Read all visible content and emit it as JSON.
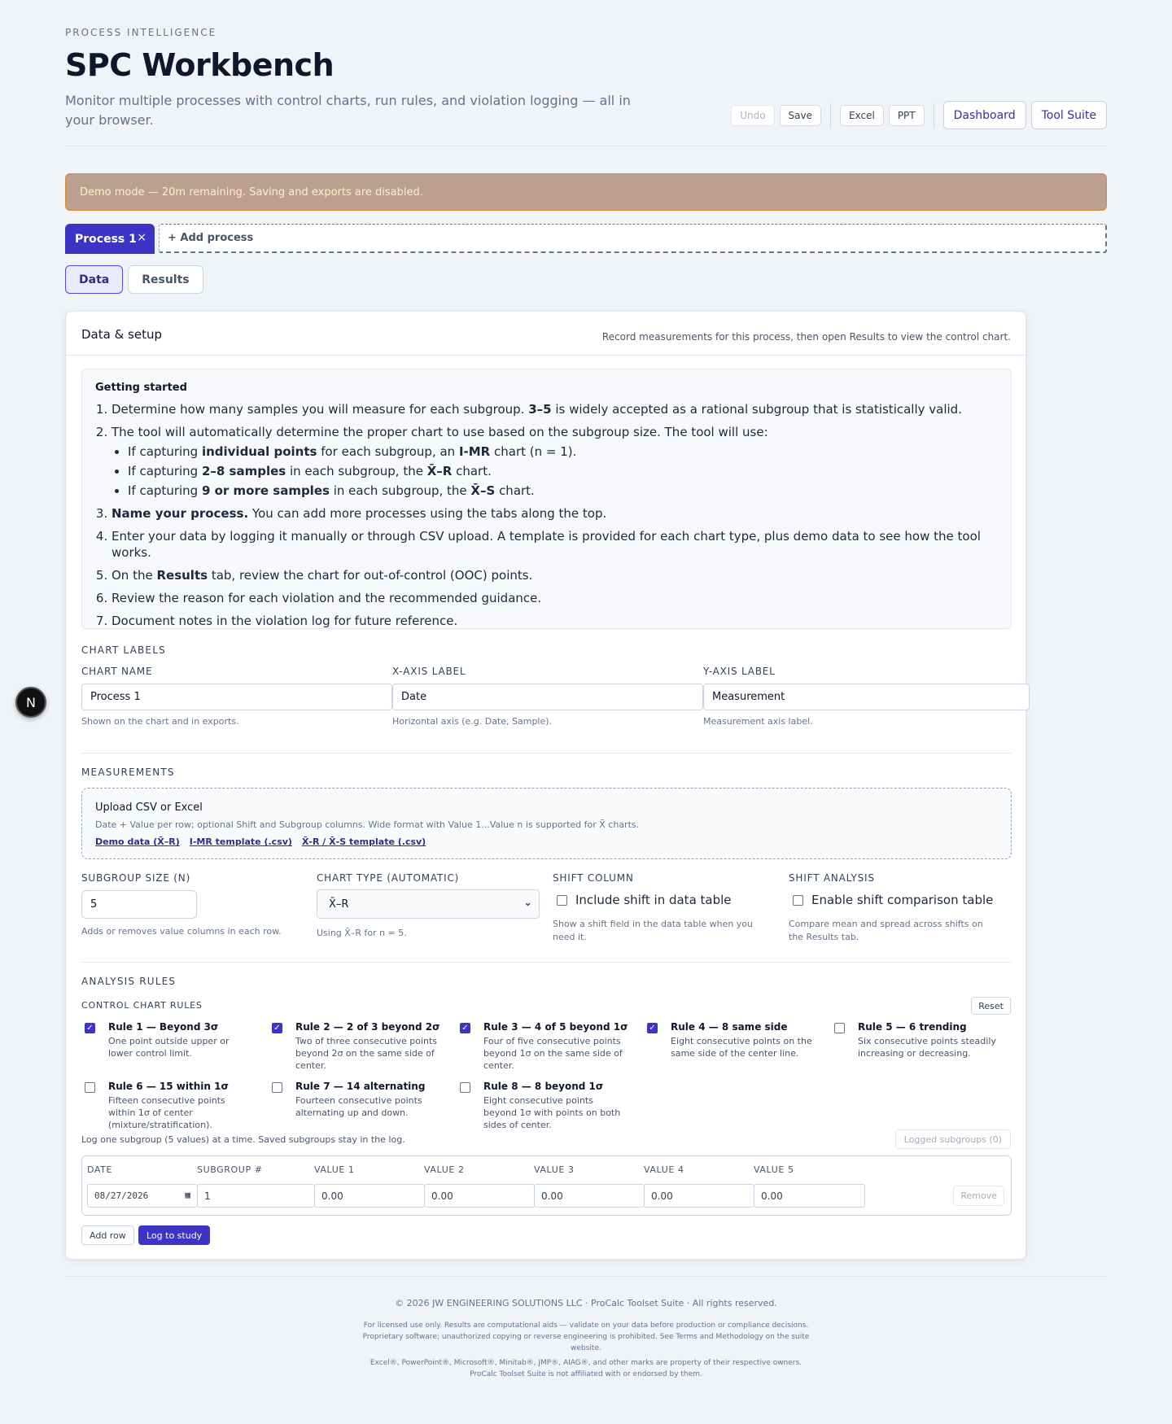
{
  "header": {
    "eyebrow": "PROCESS INTELLIGENCE",
    "title": "SPC Workbench",
    "subtitle": "Monitor multiple processes with control charts, run rules, and violation logging — all in your browser.",
    "actions": {
      "undo": "Undo",
      "save": "Save",
      "excel": "Excel",
      "ppt": "PPT",
      "dashboard": "Dashboard",
      "tool_suite": "Tool Suite"
    }
  },
  "demo_banner": "Demo mode — 20m remaining. Saving and exports are disabled.",
  "process_tabs": {
    "active": "Process 1",
    "close": "×",
    "add": "+ Add process"
  },
  "view_tabs": {
    "data": "Data",
    "results": "Results"
  },
  "card": {
    "title": "Data & setup",
    "note": "Record measurements for this process, then open Results to view the control chart."
  },
  "getting_started": {
    "title": "Getting started",
    "s1a": "Determine how many samples you will measure for each subgroup. ",
    "s1b": "3–5",
    "s1c": " is widely accepted as a rational subgroup that is statistically valid.",
    "s2": "The tool will automatically determine the proper chart to use based on the subgroup size. The tool will use:",
    "b1a": "If capturing ",
    "b1b": "individual points",
    "b1c": " for each subgroup, an ",
    "b1d": "I-MR",
    "b1e": " chart (n = 1).",
    "b2a": "If capturing ",
    "b2b": "2–8 samples",
    "b2c": " in each subgroup, the ",
    "b2d": "X̄–R",
    "b2e": " chart.",
    "b3a": "If capturing ",
    "b3b": "9 or more samples",
    "b3c": " in each subgroup, the ",
    "b3d": "X̄–S",
    "b3e": " chart.",
    "s3a": "Name your process.",
    "s3b": " You can add more processes using the tabs along the top.",
    "s4": "Enter your data by logging it manually or through CSV upload. A template is provided for each chart type, plus demo data to see how the tool works.",
    "s5a": "On the ",
    "s5b": "Results",
    "s5c": " tab, review the chart for out-of-control (OOC) points.",
    "s6": "Review the reason for each violation and the recommended guidance.",
    "s7": "Document notes in the violation log for future reference."
  },
  "chart_labels": {
    "section": "CHART LABELS",
    "chart_name": {
      "label": "CHART NAME",
      "value": "Process 1",
      "hint": "Shown on the chart and in exports."
    },
    "x_axis": {
      "label": "X-AXIS LABEL",
      "value": "Date",
      "hint": "Horizontal axis (e.g. Date, Sample)."
    },
    "y_axis": {
      "label": "Y-AXIS LABEL",
      "value": "Measurement",
      "hint": "Measurement axis label."
    }
  },
  "measurements": {
    "section": "MEASUREMENTS",
    "upload_title": "Upload CSV or Excel",
    "upload_desc": "Date + Value per row; optional Shift and Subgroup columns. Wide format with Value 1...Value n is supported for X̄ charts.",
    "links": [
      "Demo data (X̄–R)",
      "I-MR template (.csv)",
      "X̄-R / X̄-S template (.csv)"
    ],
    "subgroup_size": {
      "label": "SUBGROUP SIZE (N)",
      "value": "5",
      "hint": "Adds or removes value columns in each row."
    },
    "chart_type": {
      "label": "CHART TYPE (AUTOMATIC)",
      "value": "X̄–R",
      "hint": "Using X̄–R for n = 5."
    },
    "shift_column": {
      "label": "SHIFT COLUMN",
      "checkbox": "Include shift in data table",
      "hint": "Show a shift field in the data table when you need it."
    },
    "shift_analysis": {
      "label": "SHIFT ANALYSIS",
      "checkbox": "Enable shift comparison table",
      "hint": "Compare mean and spread across shifts on the Results tab."
    }
  },
  "analysis_rules": {
    "section": "ANALYSIS RULES",
    "subsection": "CONTROL CHART RULES",
    "reset": "Reset",
    "rules": [
      {
        "title": "Rule 1 — Beyond 3σ",
        "desc": "One point outside upper or lower control limit.",
        "checked": true
      },
      {
        "title": "Rule 2 — 2 of 3 beyond 2σ",
        "desc": "Two of three consecutive points beyond 2σ on the same side of center.",
        "checked": true
      },
      {
        "title": "Rule 3 — 4 of 5 beyond 1σ",
        "desc": "Four of five consecutive points beyond 1σ on the same side of center.",
        "checked": true
      },
      {
        "title": "Rule 4 — 8 same side",
        "desc": "Eight consecutive points on the same side of the center line.",
        "checked": true
      },
      {
        "title": "Rule 5 — 6 trending",
        "desc": "Six consecutive points steadily increasing or decreasing.",
        "checked": false
      },
      {
        "title": "Rule 6 — 15 within 1σ",
        "desc": "Fifteen consecutive points within 1σ of center (mixture/stratification).",
        "checked": false
      },
      {
        "title": "Rule 7 — 14 alternating",
        "desc": "Fourteen consecutive points alternating up and down.",
        "checked": false
      },
      {
        "title": "Rule 8 — 8 beyond 1σ",
        "desc": "Eight consecutive points beyond 1σ with points on both sides of center.",
        "checked": false
      }
    ]
  },
  "log": {
    "hint": "Log one subgroup (5 values) at a time. Saved subgroups stay in the log.",
    "logged": "Logged subgroups (0)",
    "columns": [
      "DATE",
      "SUBGROUP #",
      "VALUE 1",
      "VALUE 2",
      "VALUE 3",
      "VALUE 4",
      "VALUE 5"
    ],
    "row": {
      "date": "08/27/2026",
      "subgroup": "1",
      "values": [
        "0.00",
        "0.00",
        "0.00",
        "0.00",
        "0.00"
      ],
      "remove": "Remove"
    },
    "add_row": "Add row",
    "log_to_study": "Log to study"
  },
  "footer": {
    "copyright": "© 2026 JW ENGINEERING SOLUTIONS LLC · ProCalc Toolset Suite · All rights reserved.",
    "license": "For licensed use only. Results are computational aids — validate on your data before production or compliance decisions. Proprietary software; unauthorized copying or reverse engineering is prohibited. See Terms and Methodology on the suite website.",
    "trademarks": "Excel®, PowerPoint®, Microsoft®, Minitab®, JMP®, AIAG®, and other marks are property of their respective owners. ProCalc Toolset Suite is not affiliated with or endorsed by them."
  },
  "dev_badge": "N"
}
